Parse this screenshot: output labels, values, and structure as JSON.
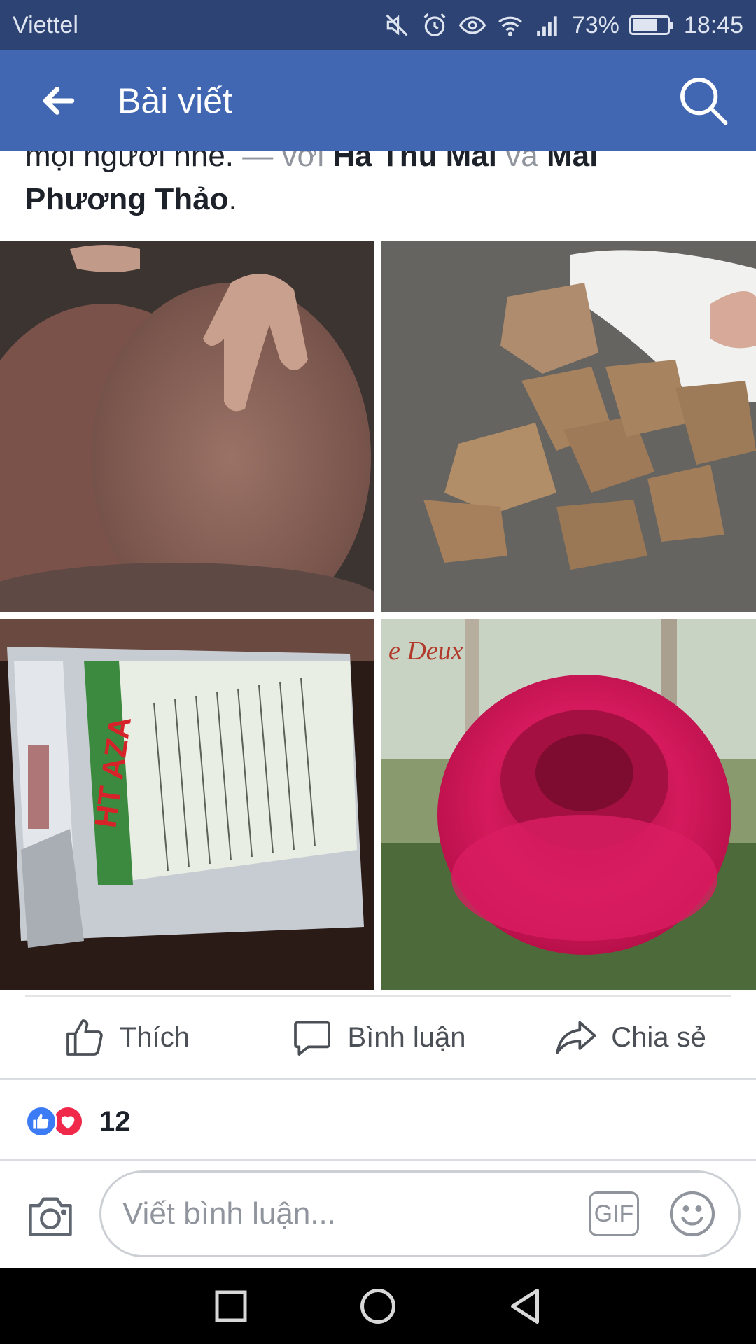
{
  "status_bar": {
    "carrier": "Viettel",
    "battery_text": "73%",
    "battery_level": 0.73,
    "time": "18:45",
    "icons": [
      "mute-icon",
      "alarm-icon",
      "eye-icon",
      "wifi-icon",
      "signal-icon",
      "battery-icon"
    ]
  },
  "app_bar": {
    "title": "Bài viết",
    "back_icon": "back-arrow-icon",
    "search_icon": "search-icon"
  },
  "post": {
    "text_prefix": "mọi người nhé.",
    "with_separator": "— với",
    "tagged_1": "Hà Thu Mai",
    "and_word": "và",
    "tagged_2": "Mai Phương Thảo",
    "end_punct": ".",
    "photos": [
      {
        "name": "dried-manure-discs-photo"
      },
      {
        "name": "broken-manure-pieces-photo"
      },
      {
        "name": "ht-aza-product-bag-photo",
        "label": "HT AZA"
      },
      {
        "name": "pink-rose-photo",
        "label": "Deux"
      }
    ]
  },
  "actions": {
    "like_label": "Thích",
    "comment_label": "Bình luận",
    "share_label": "Chia sẻ"
  },
  "reactions": {
    "count": "12",
    "types": [
      "like",
      "love"
    ]
  },
  "composer": {
    "placeholder": "Viết bình luận...",
    "gif_label": "GIF"
  },
  "colors": {
    "status_bar": "#2d4373",
    "app_bar": "#4267b2",
    "like_blue": "#3b7bf5",
    "love_red": "#f0284a"
  }
}
